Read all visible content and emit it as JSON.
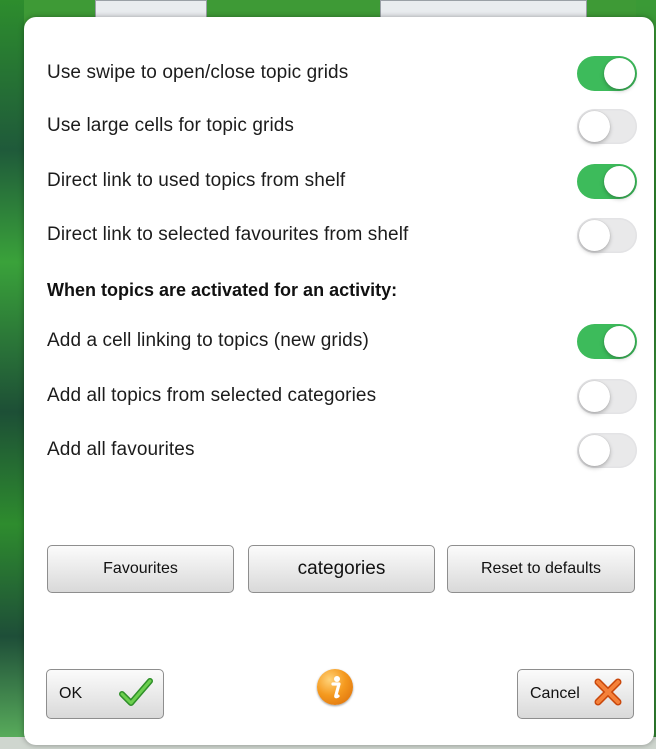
{
  "settings": [
    {
      "label": "Use swipe to open/close topic grids",
      "on": true
    },
    {
      "label": "Use large cells for topic grids",
      "on": false
    },
    {
      "label": "Direct link to used topics from shelf",
      "on": true
    },
    {
      "label": "Direct link to selected favourites from shelf",
      "on": false
    }
  ],
  "activity_heading": "When topics are activated for an activity:",
  "activity_settings": [
    {
      "label": "Add a cell linking to topics (new grids)",
      "on": true
    },
    {
      "label": "Add all topics from selected categories",
      "on": false
    },
    {
      "label": "Add all favourites",
      "on": false
    }
  ],
  "buttons": {
    "favourites": "Favourites",
    "categories": "categories",
    "reset": "Reset to defaults",
    "ok": "OK",
    "cancel": "Cancel"
  },
  "icons": {
    "ok": "checkmark-icon",
    "info": "info-icon",
    "cancel": "cross-icon"
  },
  "colors": {
    "toggle_on": "#3dbb5b",
    "toggle_off": "#e9e9ea",
    "check_green": "#3aa42f",
    "cross_orange": "#f06a1c",
    "info_orange": "#f59a1f"
  }
}
